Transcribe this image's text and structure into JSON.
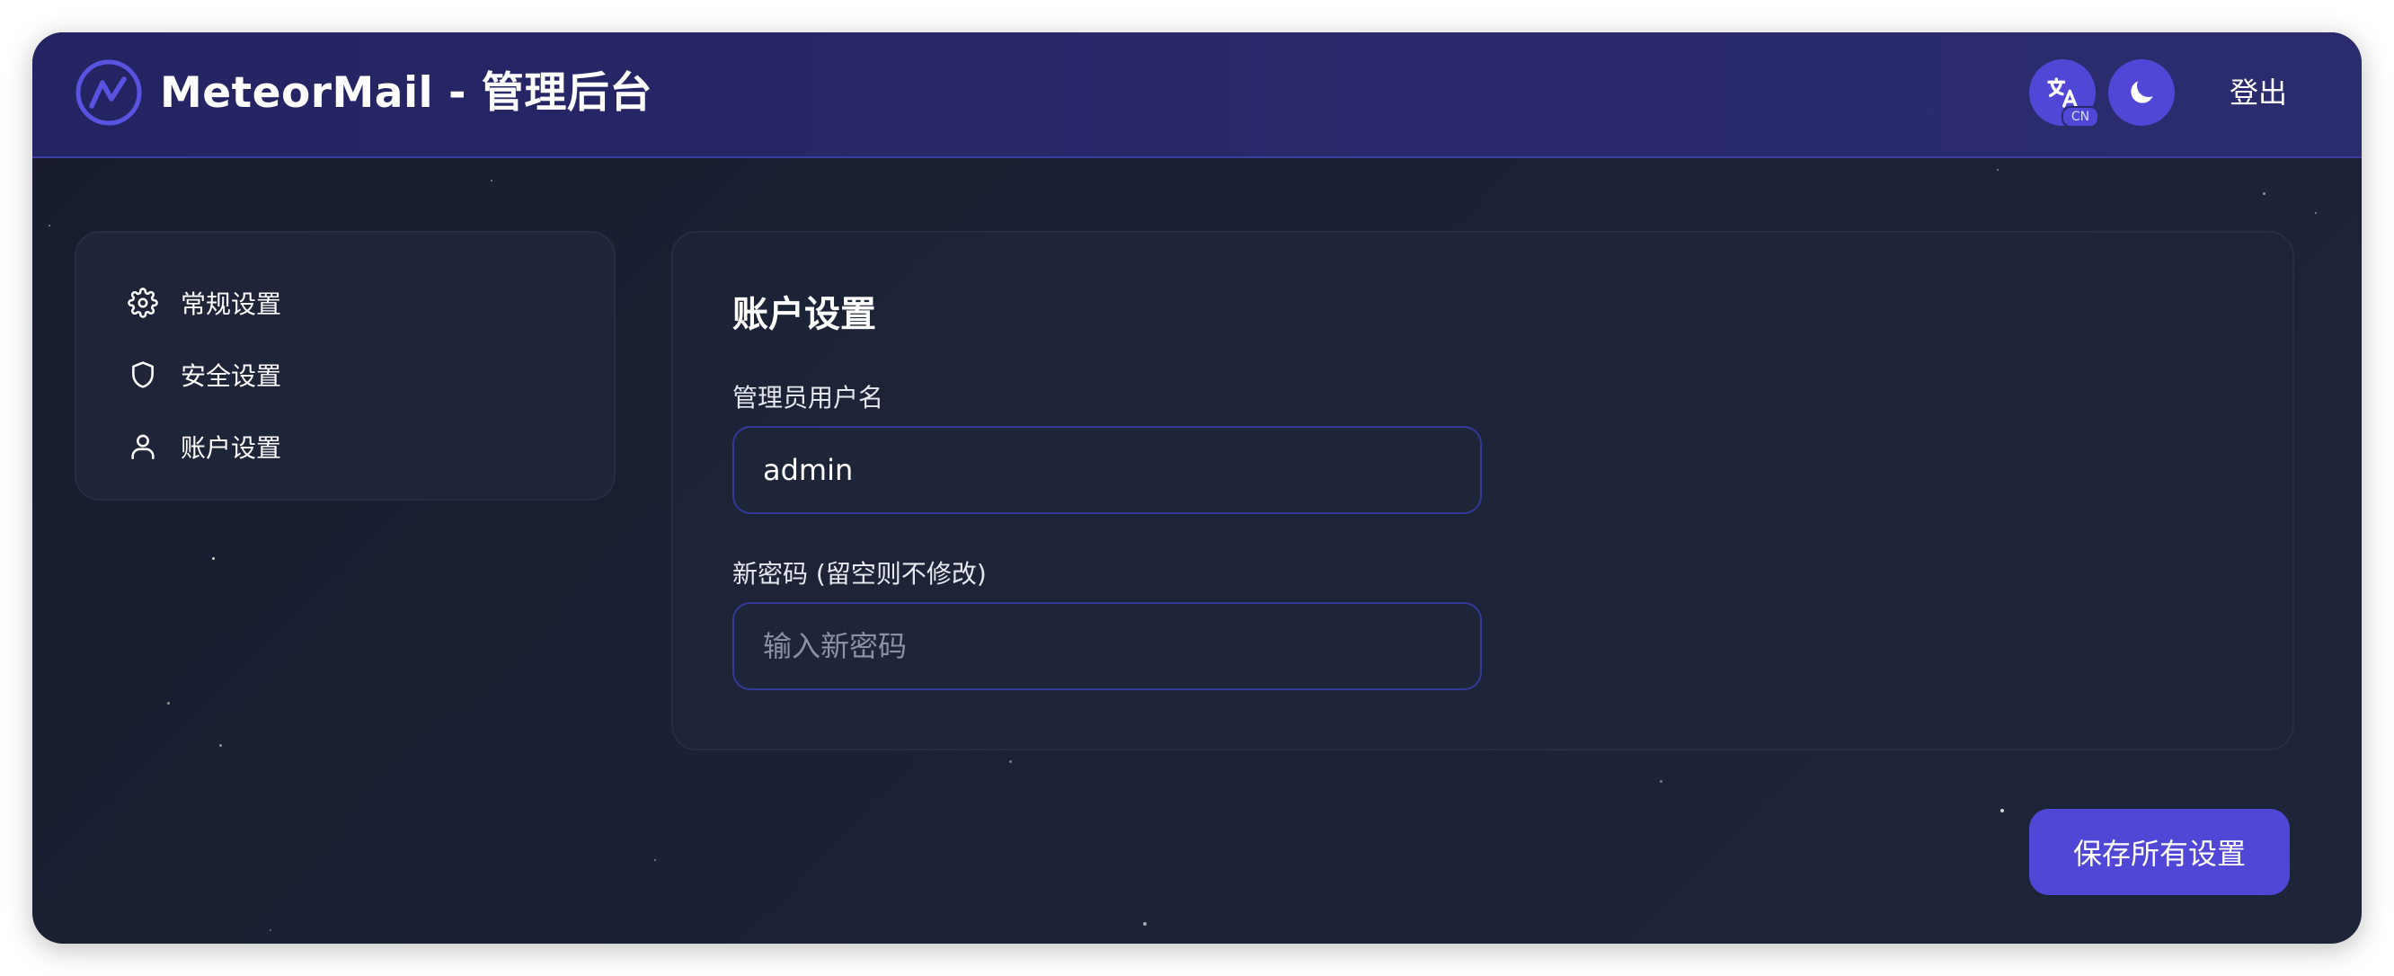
{
  "header": {
    "title": "MeteorMail - 管理后台",
    "lang_badge": "CN",
    "logout_label": "登出"
  },
  "sidebar": {
    "items": [
      {
        "label": "常规设置",
        "icon": "gear-icon"
      },
      {
        "label": "安全设置",
        "icon": "shield-icon"
      },
      {
        "label": "账户设置",
        "icon": "user-icon"
      }
    ]
  },
  "main": {
    "title": "账户设置",
    "username_label": "管理员用户名",
    "username_value": "admin",
    "password_label": "新密码 (留空则不修改)",
    "password_placeholder": "输入新密码",
    "save_label": "保存所有设置"
  },
  "colors": {
    "accent": "#5047d6",
    "header_bg": "#2a2a6c",
    "page_bg": "#1c2236"
  }
}
